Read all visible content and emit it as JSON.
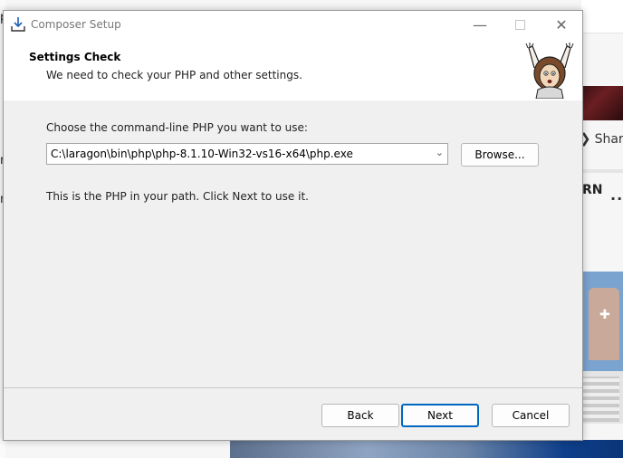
{
  "window": {
    "title": "Composer Setup"
  },
  "header": {
    "heading": "Settings Check",
    "subheading": "We need to check your PHP and other settings."
  },
  "content": {
    "prompt_label": "Choose the command-line PHP you want to use:",
    "php_path": "C:\\laragon\\bin\\php\\php-8.1.10-Win32-vs16-x64\\php.exe",
    "browse_label": "Browse...",
    "info_text": "This is the PHP in your path. Click Next to use it."
  },
  "footer": {
    "back_label": "Back",
    "next_label": "Next",
    "cancel_label": "Cancel"
  },
  "background": {
    "share_label": "Shar",
    "rn_label": "RN",
    "dots": "..",
    "left_glyph_1": "p",
    "left_glyph_2": "n",
    "left_glyph_3": "n"
  },
  "icons": {
    "app": "download-installer-icon",
    "mascot": "composer-mascot-icon",
    "minimize": "minimize-icon",
    "maximize": "maximize-icon",
    "close": "close-icon",
    "dropdown": "chevron-down-icon"
  },
  "colors": {
    "accent": "#0067c0",
    "content_bg": "#f0f0f0",
    "header_bg": "#ffffff"
  }
}
